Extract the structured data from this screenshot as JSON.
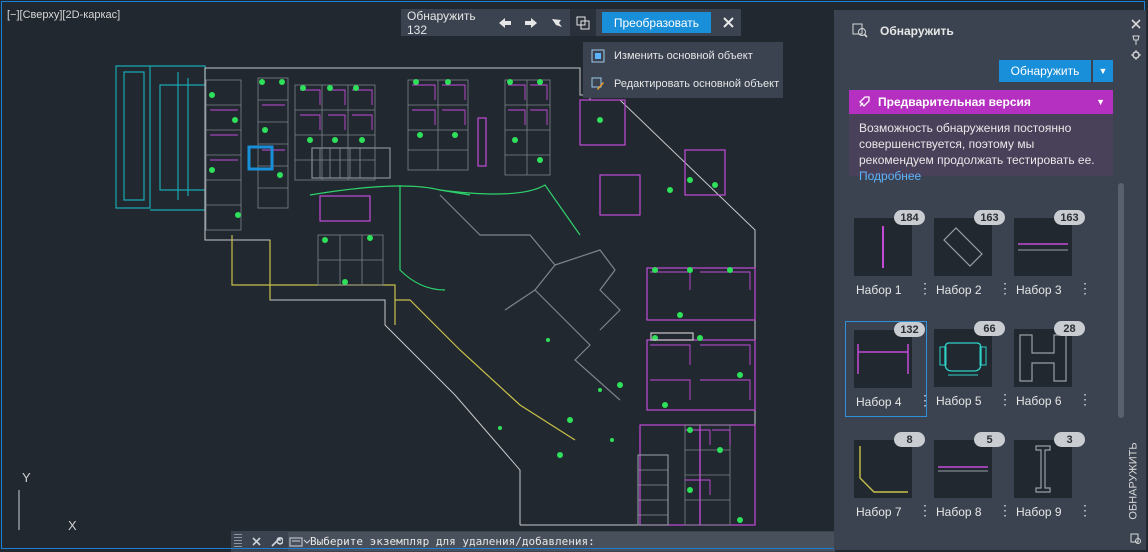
{
  "viewport": {
    "view_label": "[−][Сверху][2D-каркас]",
    "ucs": {
      "y_label": "Y",
      "x_label": "X"
    }
  },
  "detect_toolbar": {
    "label": "Обнаружить 132",
    "convert_label": "Преобразовать",
    "icons": [
      "arrow-left-icon",
      "arrow-right-icon",
      "flag-icon",
      "select-base-icon",
      "close-icon"
    ]
  },
  "dropdown_menu": {
    "items": [
      {
        "label": "Изменить основной объект"
      },
      {
        "label": "Редактировать основной объект"
      }
    ]
  },
  "command_line": {
    "prompt": "Выберите экземпляр для удаления/добавления:"
  },
  "panel": {
    "title": "Обнаружить",
    "detect_button": "Обнаружить",
    "preview": {
      "title": "Предварительная версия",
      "text": "Возможность обнаружения постоянно совершенствуется, поэтому мы рекомендуем продолжать тестировать ее.",
      "link": "Подробнее"
    },
    "sets": [
      {
        "name": "Набор 1",
        "count": "184"
      },
      {
        "name": "Набор 2",
        "count": "163"
      },
      {
        "name": "Набор 3",
        "count": "163"
      },
      {
        "name": "Набор 4",
        "count": "132"
      },
      {
        "name": "Набор 5",
        "count": "66"
      },
      {
        "name": "Набор 6",
        "count": "28"
      },
      {
        "name": "Набор 7",
        "count": "8"
      },
      {
        "name": "Набор 8",
        "count": "5"
      },
      {
        "name": "Набор 9",
        "count": "3"
      }
    ],
    "side_label": "ОБНАРУЖИТЬ",
    "accent_color": "#1a8fd9",
    "preview_color": "#b52fc0"
  }
}
